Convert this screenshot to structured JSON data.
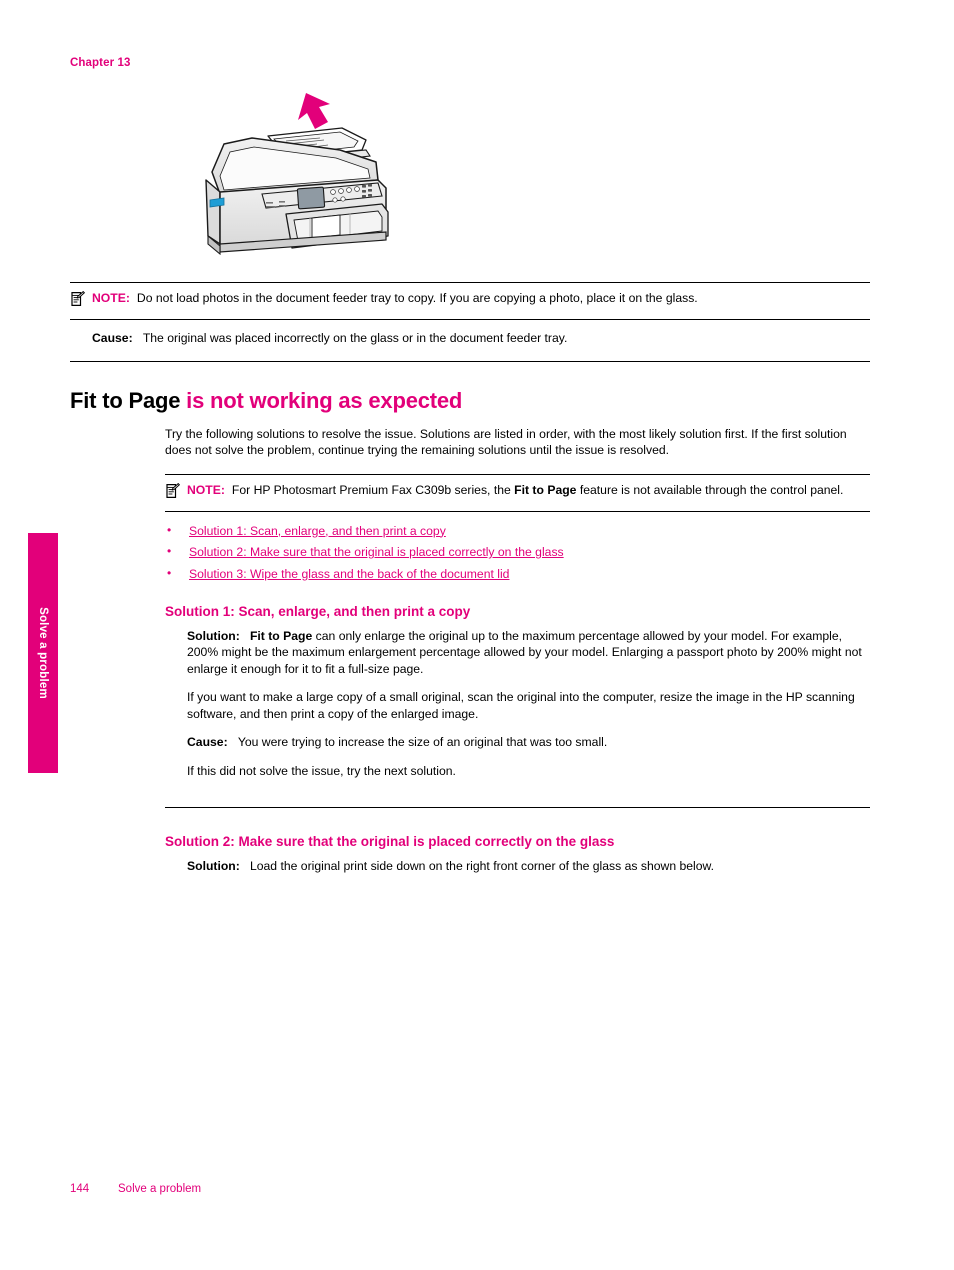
{
  "document": {
    "chapter_label": "Chapter 13",
    "side_tab_label": "Solve a problem",
    "footer_page_number": "144",
    "footer_section": "Solve a problem",
    "accent_color": "#e2007a",
    "text_color": "#000000"
  },
  "figure": {
    "name": "printer-document-feeder-illustration",
    "alt": "All-in-one printer with magenta arrow pointing to the document feeder tray",
    "arrow_color": "#e2007a"
  },
  "note_top": {
    "icon": "note-icon",
    "label": "NOTE:",
    "text": "Do not load photos in the document feeder tray to copy. If you are copying a photo, place it on the glass."
  },
  "cause_top": {
    "label": "Cause:",
    "text": "The original was placed incorrectly on the glass or in the document feeder tray."
  },
  "heading": {
    "black_part": "Fit to Page",
    "accent_part": "is not working as expected"
  },
  "intro": {
    "text": "Try the following solutions to resolve the issue. Solutions are listed in order, with the most likely solution first. If the first solution does not solve the problem, continue trying the remaining solutions until the issue is resolved."
  },
  "note_main": {
    "icon": "note-icon",
    "label": "NOTE:",
    "text_before": "For HP Photosmart Premium Fax C309b series, the ",
    "bold_term": "Fit to Page",
    "text_after": " feature is not available through the control panel."
  },
  "solution_links": [
    {
      "label": "Solution 1: Scan, enlarge, and then print a copy"
    },
    {
      "label": "Solution 2: Make sure that the original is placed correctly on the glass"
    },
    {
      "label": "Solution 3: Wipe the glass and the back of the document lid"
    }
  ],
  "solution_1": {
    "heading": "Solution 1: Scan, enlarge, and then print a copy",
    "solution_label": "Solution:",
    "solution_bold_term": "Fit to Page",
    "solution_text": " can only enlarge the original up to the maximum percentage allowed by your model. For example, 200% might be the maximum enlargement percentage allowed by your model. Enlarging a passport photo by 200% might not enlarge it enough for it to fit a full-size page.",
    "paragraph_2": "If you want to make a large copy of a small original, scan the original into the computer, resize the image in the HP scanning software, and then print a copy of the enlarged image.",
    "cause_label": "Cause:",
    "cause_text": "You were trying to increase the size of an original that was too small.",
    "next_text": "If this did not solve the issue, try the next solution."
  },
  "solution_2": {
    "heading": "Solution 2: Make sure that the original is placed correctly on the glass",
    "solution_label": "Solution:",
    "solution_text": "Load the original print side down on the right front corner of the glass as shown below."
  }
}
